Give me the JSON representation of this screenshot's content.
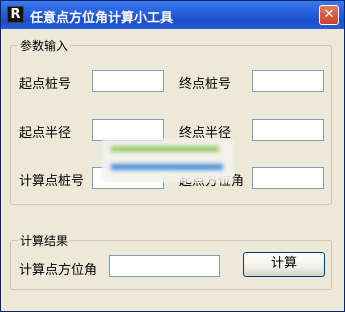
{
  "window": {
    "title": "任意点方位角计算小工具",
    "app_icon_letter": "R",
    "close_label": "✕"
  },
  "input_group": {
    "legend": "参数输入",
    "start_stake_label": "起点桩号",
    "end_stake_label": "终点桩号",
    "start_radius_label": "起点半径",
    "end_radius_label": "终点半径",
    "calc_stake_label": "计算点桩号",
    "start_azimuth_label": "起点方位角",
    "start_stake_value": "",
    "end_stake_value": "",
    "start_radius_value": "",
    "end_radius_value": "",
    "calc_stake_value": "",
    "start_azimuth_value": ""
  },
  "result_group": {
    "legend": "计算结果",
    "calc_azimuth_label": "计算点方位角",
    "calc_azimuth_value": "",
    "calculate_button": "计算"
  },
  "colors": {
    "titlebar": "#245ed9",
    "window_bg": "#ece9d8",
    "close_button": "#c8412a"
  }
}
